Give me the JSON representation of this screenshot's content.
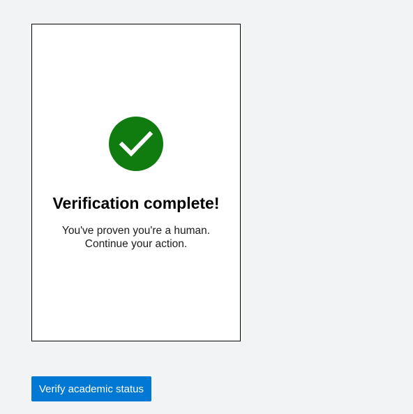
{
  "card": {
    "status_icon": "checkmark-icon",
    "status_color": "#107c10",
    "title": "Verification complete!",
    "message_line1": "You've proven you're a human.",
    "message_line2": "Continue your action."
  },
  "actions": {
    "primary_label": "Verify academic status",
    "primary_color": "#0078d4"
  }
}
